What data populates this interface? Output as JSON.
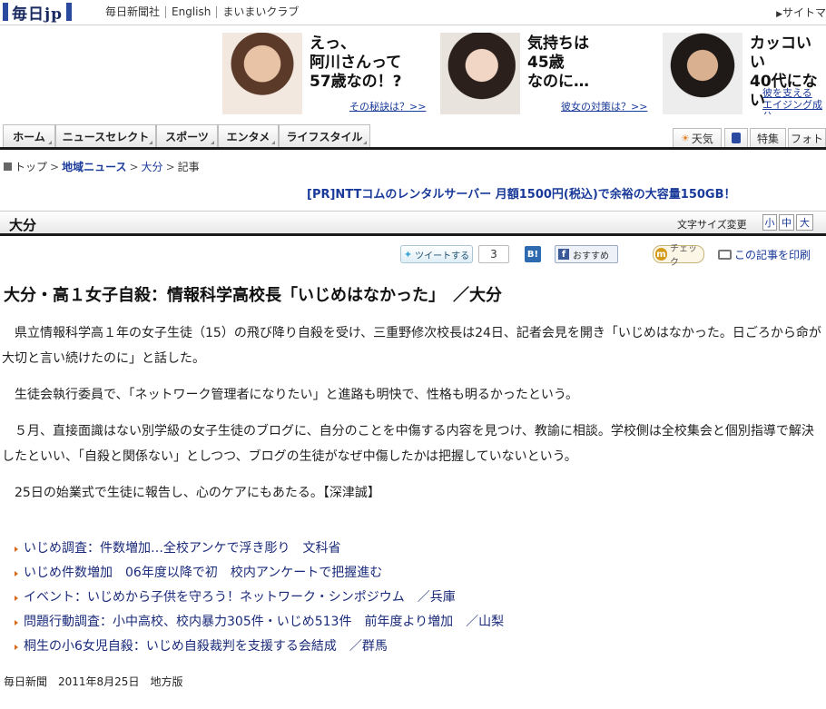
{
  "header": {
    "logo_text": "毎日jp",
    "links": [
      "毎日新聞社",
      "English",
      "まいまいクラブ"
    ],
    "sitemap": "サイトマ"
  },
  "ads": [
    {
      "headline": "えっ、\n阿川さんって\n57歳なの！?",
      "link": "その秘訣は？>>"
    },
    {
      "headline": "気持ちは\n45歳\nなのに…",
      "link": "彼女の対策は？>>"
    },
    {
      "headline": "カッコいい\n40代にない",
      "link": "彼を支える\nエイジング成分"
    }
  ],
  "nav": {
    "tabs": [
      "ホーム",
      "ニュースセレクト",
      "スポーツ",
      "エンタメ",
      "ライフスタイル"
    ],
    "right_tabs": [
      "天気",
      "",
      "特集",
      "フォト"
    ]
  },
  "breadcrumb": {
    "items": [
      "トップ",
      "地域ニュース",
      "大分",
      "記事"
    ]
  },
  "pr": "[PR]NTTコムのレンタルサーバー 月額1500円(税込)で余裕の大容量150GB！",
  "section": {
    "title": "大分",
    "font_size_label": "文字サイズ変更",
    "font_sizes": [
      "小",
      "中",
      "大"
    ]
  },
  "social": {
    "tweet": "ツイートする",
    "tweet_count": "3",
    "hatena": "B!",
    "facebook": "おすすめ",
    "mixi": "チェック",
    "print": "この記事を印刷"
  },
  "article": {
    "headline": "大分・高１女子自殺：情報科学高校長「いじめはなかった」　／大分",
    "paragraphs": [
      "県立情報科学高１年の女子生徒（15）の飛び降り自殺を受け、三重野修次校長は24日、記者会見を開き「いじめはなかった。日ごろから命が大切と言い続けたのに」と話した。",
      "生徒会執行委員で、「ネットワーク管理者になりたい」と進路も明快で、性格も明るかったという。",
      "５月、直接面識はない別学級の女子生徒のブログに、自分のことを中傷する内容を見つけ、教諭に相談。学校側は全校集会と個別指導で解決したといい、「自殺と関係ない」としつつ、ブログの生徒がなぜ中傷したかは把握していないという。",
      "25日の始業式で生徒に報告し、心のケアにもあたる。【深津誠】"
    ],
    "related": [
      "いじめ調査：件数増加…全校アンケで浮き彫り　文科省",
      "いじめ件数増加　06年度以降で初　校内アンケートで把握進む",
      "イベント：いじめから子供を守ろう！ネットワーク・シンポジウム　／兵庫",
      "問題行動調査：小中高校、校内暴力305件・いじめ513件　前年度より増加　／山梨",
      "桐生の小6女児自殺：いじめ自殺裁判を支援する会結成　／群馬"
    ],
    "footer": "毎日新聞　2011年8月25日　地方版"
  }
}
